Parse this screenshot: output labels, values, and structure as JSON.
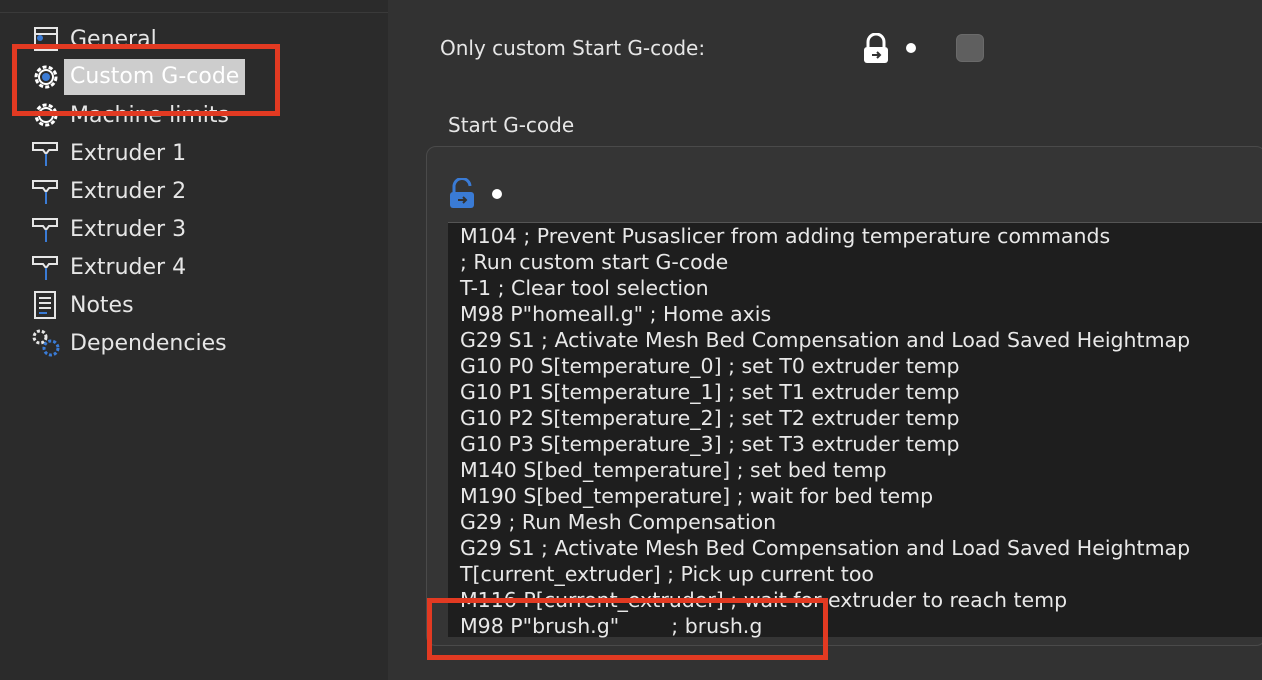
{
  "sidebar": {
    "items": [
      {
        "label": "General",
        "icon": "general-page-icon"
      },
      {
        "label": "Custom G-code",
        "icon": "gear-icon",
        "selected": true
      },
      {
        "label": "Machine limits",
        "icon": "gear-icon"
      },
      {
        "label": "Extruder 1",
        "icon": "extruder-icon"
      },
      {
        "label": "Extruder 2",
        "icon": "extruder-icon"
      },
      {
        "label": "Extruder 3",
        "icon": "extruder-icon"
      },
      {
        "label": "Extruder 4",
        "icon": "extruder-icon"
      },
      {
        "label": "Notes",
        "icon": "notes-icon"
      },
      {
        "label": "Dependencies",
        "icon": "dependencies-icon"
      }
    ]
  },
  "main": {
    "only_custom_start_label": "Only custom Start G-code:",
    "only_custom_start_checked": false,
    "start_gcode_title": "Start G-code",
    "start_gcode_lines": [
      "M104 ; Prevent Pusaslicer from adding temperature commands",
      "; Run custom start G-code",
      "T-1 ; Clear tool selection",
      "M98 P\"homeall.g\" ; Home axis",
      "G29 S1 ; Activate Mesh Bed Compensation and Load Saved Heightmap",
      "G10 P0 S[temperature_0] ; set T0 extruder temp",
      "G10 P1 S[temperature_1] ; set T1 extruder temp",
      "G10 P2 S[temperature_2] ; set T2 extruder temp",
      "G10 P3 S[temperature_3] ; set T3 extruder temp",
      "M140 S[bed_temperature] ; set bed temp",
      "M190 S[bed_temperature] ; wait for bed temp",
      "G29 ; Run Mesh Compensation",
      "G29 S1 ; Activate Mesh Bed Compensation and Load Saved Heightmap",
      "T[current_extruder] ; Pick up current too",
      "M116 P[current_extruder] ; wait for extruder to reach temp",
      "M98 P\"brush.g\"        ; brush.g"
    ]
  },
  "colors": {
    "highlight_box": "#e23a22",
    "accent_blue": "#3a7bd5",
    "sidebar_bg": "#2b2b2b",
    "main_bg": "#323232",
    "editor_bg": "#1e1e1e"
  }
}
